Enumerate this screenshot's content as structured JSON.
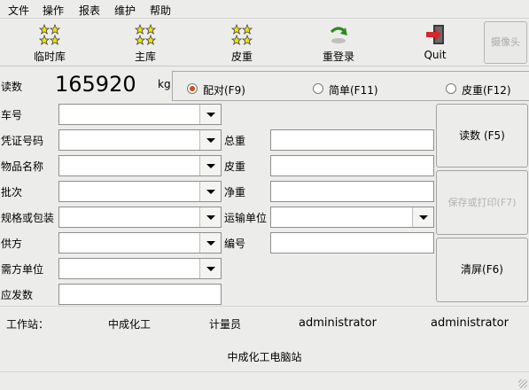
{
  "menu": {
    "items": [
      "文件",
      "操作",
      "报表",
      "维护",
      "帮助"
    ]
  },
  "toolbar": {
    "items": [
      {
        "label": "临时库",
        "icon": "stars-icon"
      },
      {
        "label": "主库",
        "icon": "stars-icon"
      },
      {
        "label": "皮重",
        "icon": "stars-icon"
      },
      {
        "label": "重登录",
        "icon": "refresh-arrow-icon"
      },
      {
        "label": "Quit",
        "icon": "exit-door-icon"
      }
    ],
    "camera_label": "摄像头"
  },
  "reading": {
    "label": "读数",
    "value": "165920",
    "unit": "kg"
  },
  "mode": {
    "options": [
      "配对(F9)",
      "简单(F11)",
      "皮重(F12)"
    ],
    "selected": "配对(F9)"
  },
  "form": {
    "left": [
      {
        "label": "车号",
        "value": ""
      },
      {
        "label": "凭证号码",
        "value": ""
      },
      {
        "label": "物品名称",
        "value": ""
      },
      {
        "label": "批次",
        "value": ""
      },
      {
        "label": "规格或包装",
        "value": ""
      },
      {
        "label": "供方",
        "value": ""
      },
      {
        "label": "需方单位",
        "value": ""
      },
      {
        "label": "应发数",
        "value": ""
      }
    ],
    "right": [
      {
        "label": "总重",
        "value": ""
      },
      {
        "label": "皮重",
        "value": ""
      },
      {
        "label": "净重",
        "value": ""
      },
      {
        "label": "运输单位",
        "value": ""
      },
      {
        "label": "编号",
        "value": ""
      }
    ]
  },
  "buttons": {
    "read": "读数 (F5)",
    "save": "保存或打印(F7)",
    "clear": "清屏(F6)"
  },
  "status": {
    "station_label": "工作站：",
    "station_value": "中成化工",
    "operator_label": "计量员",
    "operator_value": "administrator",
    "operator_value2": "administrator"
  },
  "brand": "中成化工电脑站",
  "colors": {
    "radio_selected": "#d7491c",
    "background": "#ececeb"
  }
}
